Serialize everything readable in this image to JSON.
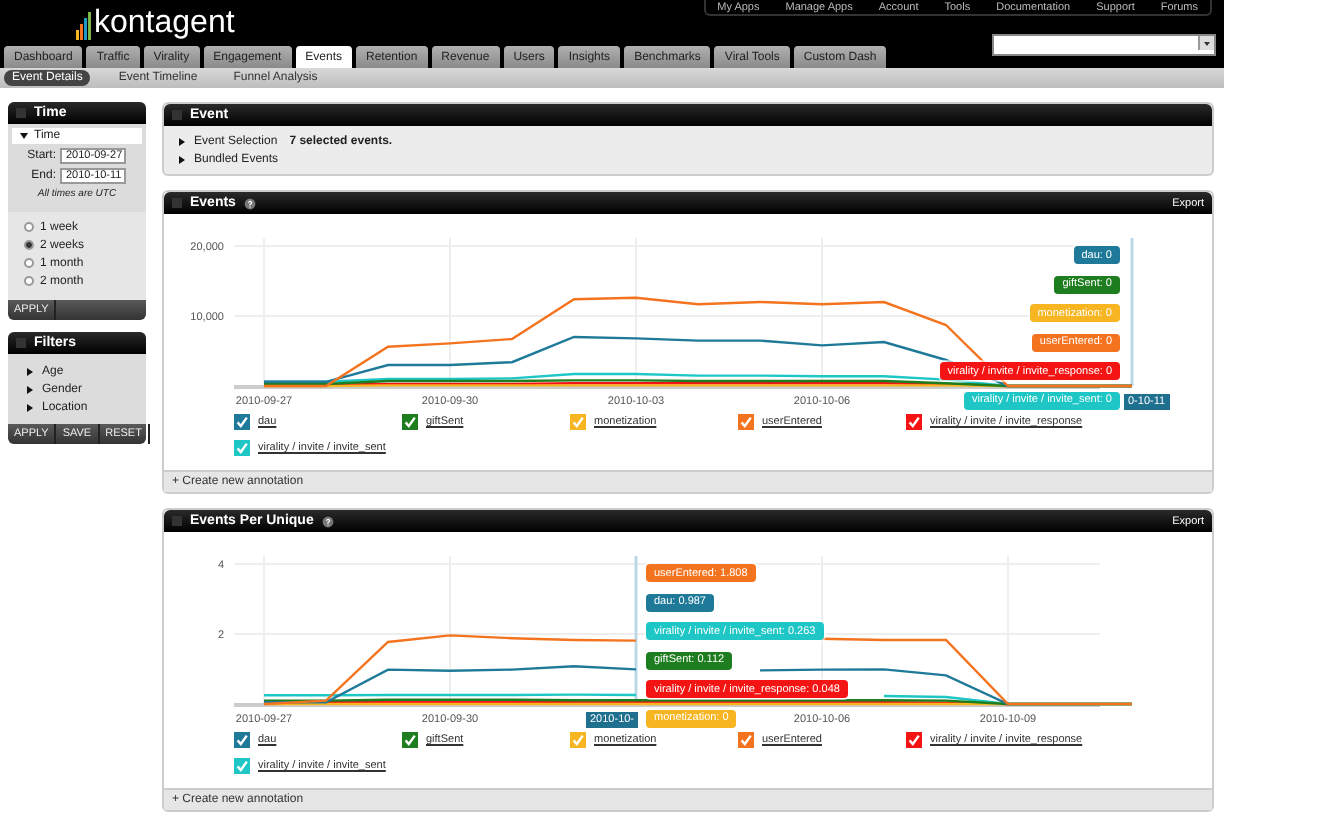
{
  "header": {
    "logo": "kontagent",
    "top_links": [
      "My Apps",
      "Manage Apps",
      "Account",
      "Tools",
      "Documentation",
      "Support",
      "Forums"
    ],
    "tabs": [
      {
        "label": "Dashboard",
        "selected": false
      },
      {
        "label": "Traffic",
        "selected": false
      },
      {
        "label": "Virality",
        "selected": false
      },
      {
        "label": "Engagement",
        "selected": false
      },
      {
        "label": "Events",
        "selected": true
      },
      {
        "label": "Retention",
        "selected": false
      },
      {
        "label": "Revenue",
        "selected": false
      },
      {
        "label": "Users",
        "selected": false
      },
      {
        "label": "Insights",
        "selected": false
      },
      {
        "label": "Benchmarks",
        "selected": false
      },
      {
        "label": "Viral Tools",
        "selected": false
      },
      {
        "label": "Custom Dash",
        "selected": false
      }
    ],
    "subtabs": [
      {
        "label": "Event Details",
        "selected": true
      },
      {
        "label": "Event Timeline",
        "selected": false
      },
      {
        "label": "Funnel Analysis",
        "selected": false
      }
    ]
  },
  "time_panel": {
    "title": "Time",
    "section": {
      "label": "Time",
      "expanded": true
    },
    "start": {
      "label": "Start:",
      "value": "2010-09-27"
    },
    "end": {
      "label": "End:",
      "value": "2010-10-11"
    },
    "note": "All times are UTC",
    "ranges": [
      {
        "label": "1 week",
        "selected": false
      },
      {
        "label": "2 weeks",
        "selected": true
      },
      {
        "label": "1 month",
        "selected": false
      },
      {
        "label": "2 month",
        "selected": false
      }
    ],
    "buttons": [
      "APPLY"
    ]
  },
  "filters_panel": {
    "title": "Filters",
    "items": [
      {
        "label": "Age",
        "expanded": false
      },
      {
        "label": "Gender",
        "expanded": false
      },
      {
        "label": "Location",
        "expanded": false
      }
    ],
    "buttons": [
      "APPLY",
      "SAVE",
      "RESET"
    ]
  },
  "event_panel": {
    "title": "Event",
    "rows": [
      {
        "label": "Event Selection",
        "value": "7 selected events.",
        "expanded": false
      },
      {
        "label": "Bundled Events",
        "expanded": false
      }
    ]
  },
  "charts": [
    {
      "title": "Events",
      "export": "Export",
      "footer": "+ Create new annotation",
      "chart_data": {
        "type": "line",
        "categories": [
          "2010-09-27",
          null,
          null,
          "2010-09-30",
          null,
          null,
          "2010-10-03",
          null,
          null,
          "2010-10-06",
          null,
          null,
          null,
          null,
          null
        ],
        "grid": true,
        "legend": "bottom",
        "ylim": [
          0,
          20000
        ],
        "yticks": [
          {
            "value": 10000,
            "label": "10,000"
          },
          {
            "value": 20000,
            "label": "20,000"
          }
        ],
        "series": [
          {
            "name": "dau",
            "color": "#1f7a99",
            "values": [
              600,
              600,
              3000,
              3000,
              3400,
              7000,
              6800,
              6500,
              6500,
              5800,
              6300,
              3700,
              0,
              0,
              0
            ]
          },
          {
            "name": "giftSent",
            "color": "#1e7d1e",
            "values": [
              300,
              300,
              700,
              700,
              700,
              800,
              800,
              700,
              700,
              700,
              700,
              400,
              0,
              0,
              0
            ]
          },
          {
            "name": "monetization",
            "color": "#f7b521",
            "values": [
              0,
              0,
              100,
              100,
              100,
              100,
              100,
              100,
              100,
              100,
              100,
              100,
              0,
              0,
              0
            ]
          },
          {
            "name": "userEntered",
            "color": "#f4731f",
            "values": [
              0,
              0,
              5600,
              6100,
              6700,
              12400,
              12600,
              11700,
              12000,
              11700,
              12000,
              8700,
              0,
              0,
              0
            ]
          },
          {
            "name": "virality / invite / invite_response",
            "color": "#f41414",
            "values": [
              200,
              200,
              300,
              300,
              300,
              400,
              400,
              400,
              400,
              400,
              400,
              300,
              0,
              0,
              0
            ]
          },
          {
            "name": "virality / invite / invite_sent",
            "color": "#1fc6c6",
            "values": [
              600,
              600,
              1000,
              1000,
              1100,
              1700,
              1700,
              1500,
              1500,
              1400,
              1400,
              900,
              0,
              0,
              0
            ]
          }
        ],
        "annotations": [
          "0-10-11"
        ]
      },
      "legend_items": [
        {
          "checked": true
        },
        {
          "checked": true
        },
        {
          "checked": true
        },
        {
          "checked": true
        },
        {
          "checked": true
        },
        {
          "checked": true
        }
      ],
      "hover": {
        "tooltips": [
          {
            "text": "dau: 0",
            "color": "#1f7a99"
          },
          {
            "text": "giftSent: 0",
            "color": "#1e7d1e"
          },
          {
            "text": "monetization: 0",
            "color": "#f7b521"
          },
          {
            "text": "userEntered: 0",
            "color": "#f4731f"
          },
          {
            "text": "virality / invite / invite_response: 0",
            "color": "#f41414"
          },
          {
            "text": "virality / invite / invite_sent: 0",
            "color": "#1fc6c6"
          }
        ]
      }
    },
    {
      "title": "Events Per Unique",
      "export": "Export",
      "footer": "+ Create new annotation",
      "chart_data": {
        "type": "line",
        "categories": [
          "2010-09-27",
          null,
          null,
          "2010-09-30",
          null,
          null,
          null,
          null,
          null,
          "2010-10-06",
          null,
          null,
          "2010-10-09",
          null,
          null
        ],
        "grid": true,
        "legend": "bottom",
        "ylim": [
          0,
          4
        ],
        "yticks": [
          {
            "value": 2,
            "label": "2"
          },
          {
            "value": 4,
            "label": "4"
          }
        ],
        "series": [
          {
            "name": "dau",
            "color": "#1f7a99",
            "values": [
              0.05,
              0.05,
              0.98,
              0.95,
              0.98,
              1.08,
              0.99,
              null,
              0.96,
              0.98,
              0.99,
              0.82,
              0,
              0,
              0
            ]
          },
          {
            "name": "giftSent",
            "color": "#1e7d1e",
            "values": [
              0.1,
              0.1,
              0.12,
              0.12,
              0.12,
              0.11,
              0.11,
              0.11,
              0.11,
              0.11,
              0.11,
              0.1,
              0,
              0,
              0
            ]
          },
          {
            "name": "monetization",
            "color": "#f7b521",
            "values": [
              0,
              0,
              0,
              0,
              0,
              0,
              0,
              0,
              0,
              0,
              0,
              0,
              0,
              0,
              0
            ]
          },
          {
            "name": "userEntered",
            "color": "#f4731f",
            "values": [
              0,
              0.1,
              1.77,
              1.96,
              1.88,
              1.83,
              1.81,
              null,
              null,
              1.86,
              1.83,
              1.83,
              0,
              0,
              0
            ]
          },
          {
            "name": "virality / invite / invite_response",
            "color": "#f41414",
            "values": [
              0.05,
              0.05,
              0.06,
              0.05,
              0.05,
              0.05,
              0.05,
              0.05,
              0.05,
              0.05,
              0.05,
              0.04,
              0,
              null,
              null
            ]
          },
          {
            "name": "virality / invite / invite_sent",
            "color": "#1fc6c6",
            "values": [
              0.25,
              0.25,
              0.26,
              0.26,
              0.26,
              0.27,
              0.26,
              null,
              null,
              null,
              0.23,
              0.2,
              0,
              0,
              0
            ]
          }
        ],
        "annotations": [
          "2010-10-"
        ]
      },
      "legend_items": [
        {
          "checked": true
        },
        {
          "checked": true
        },
        {
          "checked": true
        },
        {
          "checked": true
        },
        {
          "checked": true
        },
        {
          "checked": true
        }
      ],
      "hover": {
        "tooltips": [
          {
            "text": "userEntered: 1.808",
            "color": "#f4731f"
          },
          {
            "text": "dau: 0.987",
            "color": "#1f7a99"
          },
          {
            "text": "virality / invite / invite_sent: 0.263",
            "color": "#1fc6c6"
          },
          {
            "text": "giftSent: 0.112",
            "color": "#1e7d1e"
          },
          {
            "text": "virality / invite / invite_response: 0.048",
            "color": "#f41414"
          },
          {
            "text": "monetization: 0",
            "color": "#f7b521"
          }
        ]
      }
    }
  ]
}
